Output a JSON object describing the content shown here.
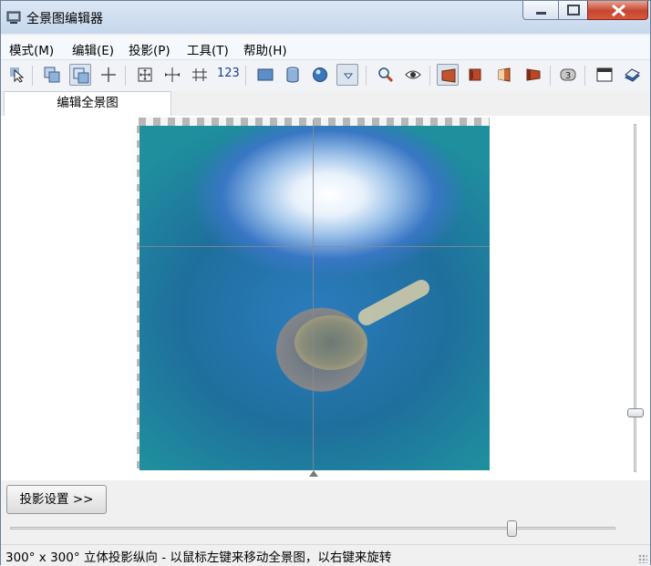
{
  "window": {
    "title": "全景图编辑器"
  },
  "menu": {
    "items": [
      "模式(M)",
      "编辑(E)",
      "投影(P)",
      "工具(T)",
      "帮助(H)"
    ]
  },
  "toolbar": {
    "number_label": "123",
    "badge_label": "3",
    "icons": [
      "select-arrow-icon",
      "move-pano-icon",
      "move-pano-pressed-icon",
      "crosshair-icon",
      "expand-icon",
      "center-h-icon",
      "center-v-icon",
      "numbers-icon",
      "rectangle-projection-icon",
      "cylinder-projection-icon",
      "sphere-projection-icon",
      "projection-dropdown-icon",
      "zoom-icon",
      "preview-eye-icon",
      "brown-panel-1-icon",
      "brown-panel-2-icon",
      "brown-panel-3-icon",
      "brown-panel-4-icon",
      "badge-3-icon",
      "window-icon",
      "book-icon"
    ]
  },
  "tabs": {
    "active": "编辑全景图"
  },
  "controls": {
    "projection_settings_label": "投影设置 >>"
  },
  "status": {
    "text": "300° x 300° 立体投影纵向 - 以鼠标左键来移动全景图，以右键来旋转"
  },
  "colors": {
    "titlebar": "#c6d7ec",
    "close_button": "#c6452f",
    "accent": "#1d3f8f"
  }
}
